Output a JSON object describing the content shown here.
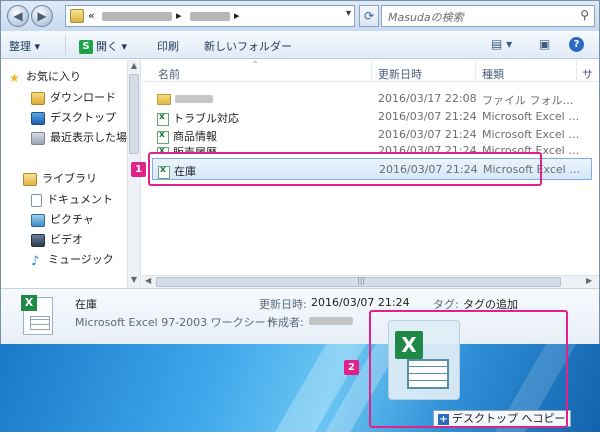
{
  "addressbar": {
    "history_arrow": "«",
    "path_separator": "▸",
    "dropdown": "▾",
    "refresh_icon": "refresh-icon",
    "search_placeholder": "Masudaの検索"
  },
  "toolbar": {
    "organize": "整理 ▾",
    "open_icon": "S",
    "open": "開く ▾",
    "print": "印刷",
    "new_folder": "新しいフォルダー",
    "views_icon": "▤ ▾",
    "help": "?"
  },
  "sidebar": {
    "items": [
      {
        "label": "お気に入り",
        "icon": "star-icon"
      },
      {
        "label": "ダウンロード",
        "icon": "download-folder-icon"
      },
      {
        "label": "デスクトップ",
        "icon": "desktop-icon"
      },
      {
        "label": "最近表示した場所",
        "icon": "recent-places-icon"
      },
      {
        "label": "ライブラリ",
        "icon": "library-icon"
      },
      {
        "label": "ドキュメント",
        "icon": "documents-icon"
      },
      {
        "label": "ピクチャ",
        "icon": "pictures-icon"
      },
      {
        "label": "ビデオ",
        "icon": "videos-icon"
      },
      {
        "label": "ミュージック",
        "icon": "music-icon"
      }
    ]
  },
  "list": {
    "columns": {
      "name": "名前",
      "modified": "更新日時",
      "type": "種類",
      "size": "サ"
    },
    "rows": [
      {
        "name": "",
        "modified": "2016/03/17 22:08",
        "type": "ファイル フォル…",
        "kind": "folder"
      },
      {
        "name": "トラブル対応",
        "modified": "2016/03/07 21:24",
        "type": "Microsoft Excel …",
        "kind": "excel"
      },
      {
        "name": "商品情報",
        "modified": "2016/03/07 21:24",
        "type": "Microsoft Excel …",
        "kind": "excel"
      },
      {
        "name": "販売履歴",
        "modified": "2016/03/07 21:24",
        "type": "Microsoft Excel …",
        "kind": "excel"
      },
      {
        "name": "在庫",
        "modified": "2016/03/07 21:24",
        "type": "Microsoft Excel …",
        "kind": "excel",
        "selected": true
      }
    ]
  },
  "details": {
    "name": "在庫",
    "type": "Microsoft Excel 97-2003 ワークシート",
    "modified_label": "更新日時:",
    "modified_value": "2016/03/07 21:24",
    "tags_label": "タグ:",
    "tags_value": "タグの追加",
    "author_label": "作成者:"
  },
  "drag": {
    "tooltip": "デスクトップ へコピー"
  },
  "callouts": {
    "one": "1",
    "two": "2",
    "color": "#e0228a"
  }
}
